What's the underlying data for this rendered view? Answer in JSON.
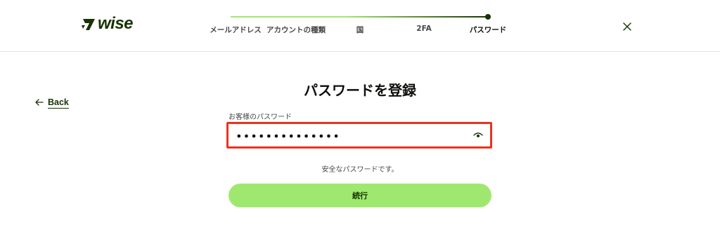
{
  "brand": {
    "name": "wise",
    "color": "#163300",
    "accent": "#9fe870"
  },
  "stepper": {
    "steps": [
      {
        "label": "メールアドレス",
        "state": "done"
      },
      {
        "label": "アカウントの種類",
        "state": "done"
      },
      {
        "label": "国",
        "state": "done"
      },
      {
        "label": "2FA",
        "state": "done"
      },
      {
        "label": "パスワード",
        "state": "active"
      }
    ],
    "progress": 1.0
  },
  "header": {
    "close_icon": "close-icon"
  },
  "back": {
    "label": "Back",
    "icon": "arrow-left-icon"
  },
  "main": {
    "title": "パスワードを登録",
    "password_field": {
      "label": "お客様のパスワード",
      "value": "••••••••••••••",
      "toggle_icon": "eye-icon",
      "highlight_color": "#e8331f"
    },
    "hint": "安全なパスワードです。",
    "continue_label": "続行"
  }
}
